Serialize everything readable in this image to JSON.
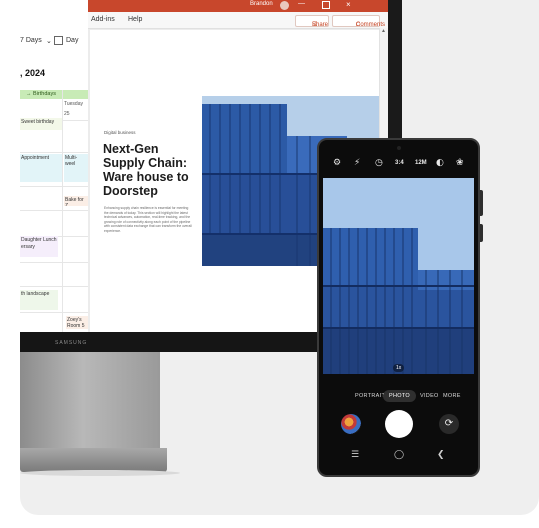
{
  "calendar": {
    "view_7days": "7 Days",
    "view_day": "Day",
    "year_fragment": ", 2024",
    "birthday_banner": "→  Birthdays",
    "day_name": "Tuesday",
    "day_number": "25",
    "events": [
      "Sweet birthday",
      "Appointment",
      "Multi-weel",
      "Bake for Z",
      "Daughter Lunch",
      "ersary",
      "th landscape",
      "Zoey's Ca",
      "Room 5"
    ]
  },
  "powerpoint": {
    "user": "Brandon",
    "menu_addins": "Add-ins",
    "menu_help": "Help",
    "share_label": "Share",
    "comments_label": "Comments",
    "slide_eyebrow": "Digital business",
    "slide_title": "Next-Gen\nSupply Chain:\nWare house to\nDoorstep",
    "slide_body": "Enhancing supply chain resilience is essential for meeting the demands of today. This section will highlight the latest technical advances, automation, real-time tracking, and the growing role of connectivity along each point of the pipeline with consistent data exchange that can transform the overall experience."
  },
  "monitor": {
    "brand": "SAMSUNG"
  },
  "phone": {
    "camera_top": {
      "ratio": "3:4",
      "megapixels": "12M"
    },
    "zoom": "1x",
    "modes": [
      "PORTRAIT",
      "PHOTO",
      "VIDEO",
      "MORE"
    ],
    "active_mode": "PHOTO"
  },
  "icons": {
    "settings": "gear-icon",
    "flash": "flash-icon",
    "timer": "timer-icon",
    "motion": "motion-photo-icon",
    "filters": "filters-icon",
    "flip": "flip-camera-icon",
    "recents": "recents-icon",
    "home": "home-icon",
    "back": "back-icon"
  },
  "colors": {
    "ppt_accent": "#c8472c",
    "birthday": "#c8ebb6",
    "container_blue": "#2f5fae",
    "sky": "#a8c7ea"
  }
}
